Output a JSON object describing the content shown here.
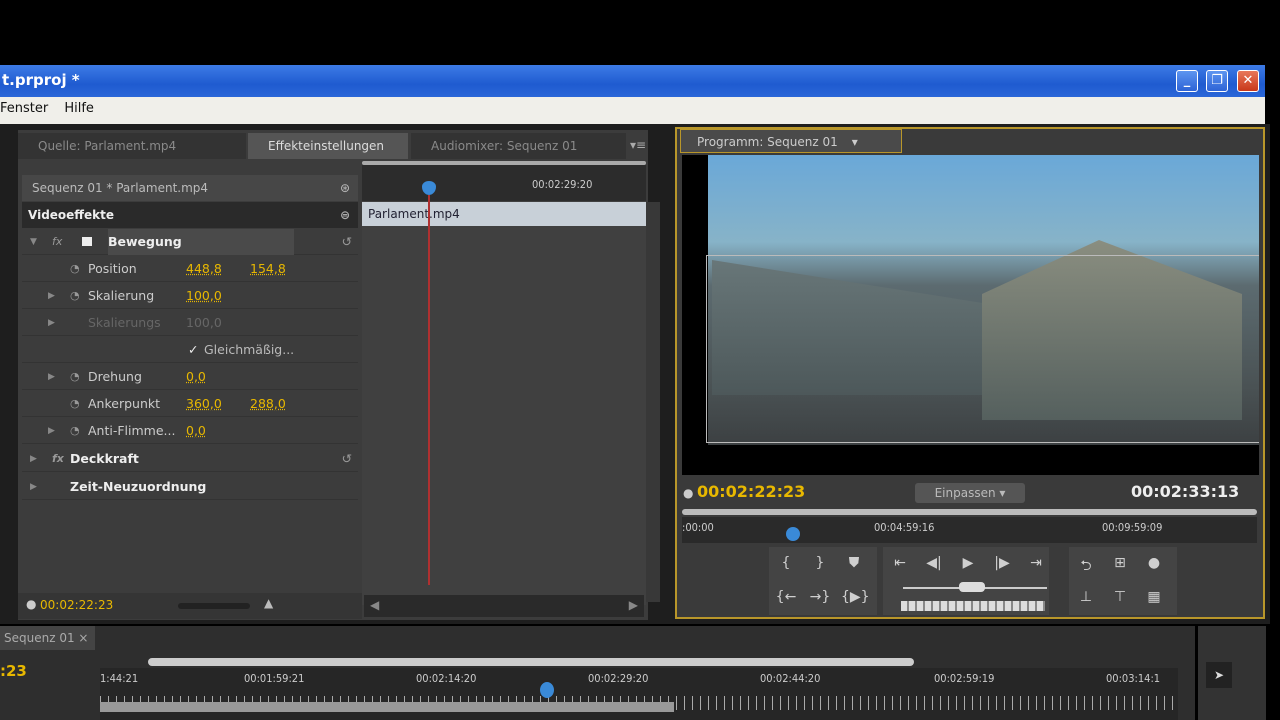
{
  "window": {
    "title": "t.prproj *",
    "buttons": [
      "minimize",
      "maximize",
      "close"
    ]
  },
  "menu": [
    "Fenster",
    "Hilfe"
  ],
  "left_panel": {
    "tabs": [
      {
        "label": "Quelle: Parlament.mp4"
      },
      {
        "label": "Effekteinstellungen",
        "active": true
      },
      {
        "label": "Audiomixer: Sequenz 01"
      }
    ],
    "clip_header": "Sequenz 01 * Parlament.mp4",
    "section": "Videoeffekte",
    "timeline_time": "00:02:29:20",
    "clip_name": "Parlament.mp4",
    "effects": [
      {
        "name": "Bewegung",
        "type": "group"
      },
      {
        "name": "Position",
        "v1": "448,8",
        "v2": "154,8"
      },
      {
        "name": "Skalierung",
        "v1": "100,0"
      },
      {
        "name": "Skalierungs",
        "v1": "100,0",
        "disabled": true
      },
      {
        "name": "Gleichmäßig...",
        "type": "checkbox",
        "checked": true
      },
      {
        "name": "Drehung",
        "v1": "0,0"
      },
      {
        "name": "Ankerpunkt",
        "v1": "360,0",
        "v2": "288,0"
      },
      {
        "name": "Anti-Flimme...",
        "v1": "0,0"
      },
      {
        "name": "Deckkraft",
        "type": "group"
      },
      {
        "name": "Zeit-Neuzuordnung",
        "type": "group"
      }
    ],
    "current_time": "00:02:22:23"
  },
  "program": {
    "tab": "Programm: Sequenz 01",
    "current_time": "00:02:22:23",
    "zoom_select": "Einpassen",
    "duration": "00:02:33:13",
    "ruler": [
      ":00:00",
      "00:04:59:16",
      "00:09:59:09"
    ],
    "colors": {
      "accent": "#e8b800",
      "border": "#b8962a"
    }
  },
  "sequence": {
    "tab": "Sequenz 01",
    "time_fragment": ":23",
    "ruler": [
      "1:44:21",
      "00:01:59:21",
      "00:02:14:20",
      "00:02:29:20",
      "00:02:44:20",
      "00:02:59:19",
      "00:03:14:1"
    ]
  }
}
